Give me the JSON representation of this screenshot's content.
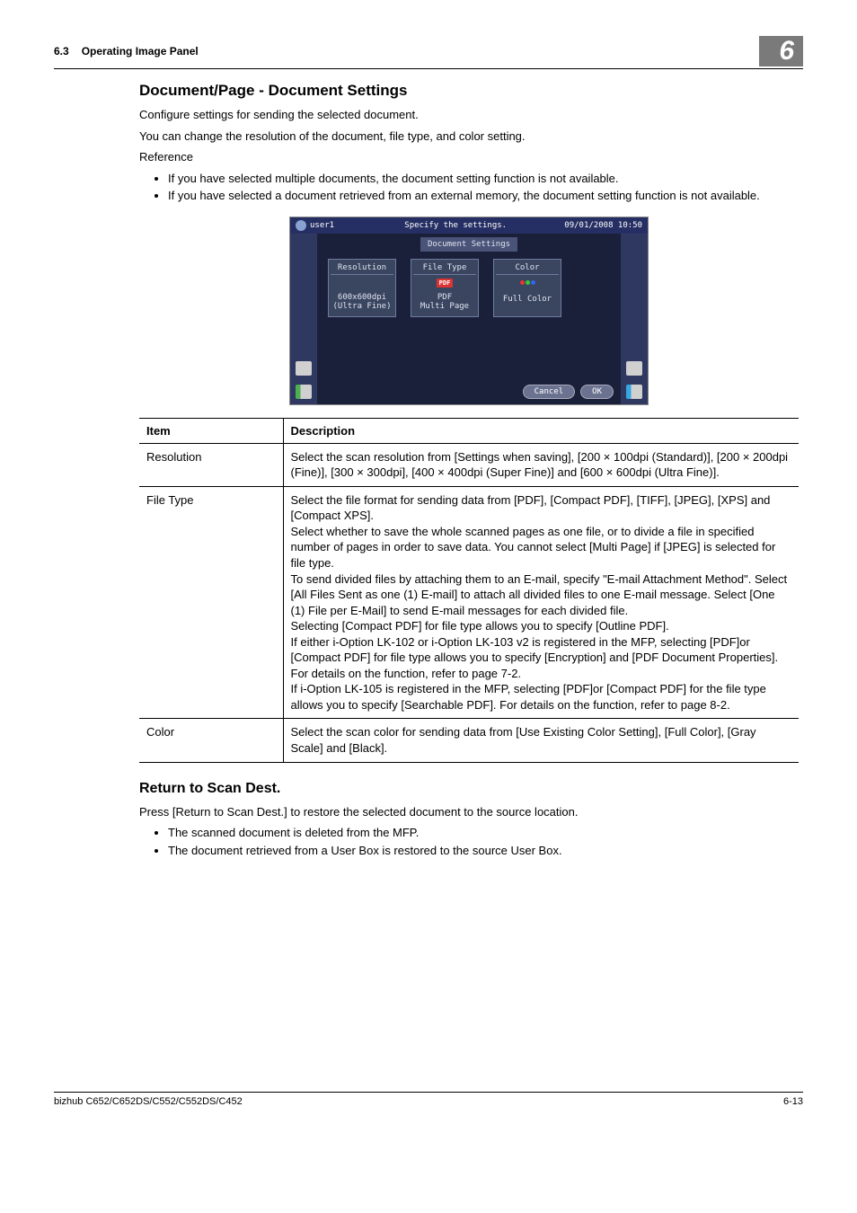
{
  "header": {
    "section_num": "6.3",
    "section_title": "Operating Image Panel",
    "chapter_num": "6"
  },
  "h2_docset": "Document/Page - Document Settings",
  "p_intro1": "Configure settings for sending the selected document.",
  "p_intro2": "You can change the resolution of the document, file type, and color setting.",
  "p_ref": "Reference",
  "bullets_ref": [
    "If you have selected multiple documents, the document setting function is not available.",
    "If you have selected a document retrieved from an external memory, the document setting function is not available."
  ],
  "mfp": {
    "user": "user1",
    "message": "Specify the settings.",
    "datetime": "09/01/2008  10:50",
    "panel_title": "Document Settings",
    "tiles": {
      "resolution": {
        "title": "Resolution",
        "line1": "600x600dpi",
        "line2": "(Ultra Fine)"
      },
      "filetype": {
        "title": "File Type",
        "badge": "PDF",
        "line1": "PDF",
        "line2": "Multi Page"
      },
      "color": {
        "title": "Color",
        "line1": "Full Color"
      }
    },
    "btn_cancel": "Cancel",
    "btn_ok": "OK"
  },
  "table": {
    "head_item": "Item",
    "head_desc": "Description",
    "rows": [
      {
        "item": "Resolution",
        "desc": "Select the scan resolution from [Settings when saving], [200 × 100dpi (Standard)], [200 × 200dpi (Fine)], [300 × 300dpi], [400 × 400dpi (Super Fine)] and [600 × 600dpi (Ultra Fine)]."
      },
      {
        "item": "File Type",
        "desc": "Select the file format for sending data from [PDF], [Compact PDF], [TIFF], [JPEG], [XPS] and [Compact XPS].\nSelect whether to save the whole scanned pages as one file, or to divide a file in specified number of pages in order to save data. You cannot select [Multi Page] if [JPEG] is selected for file type.\nTo send divided files by attaching them to an E-mail, specify \"E-mail Attachment Method\". Select [All Files Sent as one (1) E-mail] to attach all divided files to one E-mail message. Select [One (1) File per E-Mail] to send E-mail messages for each divided file.\nSelecting [Compact PDF] for file type allows you to specify [Outline PDF].\nIf either i-Option LK-102 or i-Option LK-103 v2 is registered in the MFP, selecting [PDF]or [Compact PDF] for file type allows you to specify [Encryption] and [PDF Document Properties]. For details on the function, refer to page 7-2.\nIf i-Option LK-105 is registered in the MFP, selecting [PDF]or [Compact PDF] for the file type allows you to specify [Searchable PDF]. For details on the function, refer to page 8-2."
      },
      {
        "item": "Color",
        "desc": "Select the scan color for sending data from [Use Existing Color Setting], [Full Color], [Gray Scale] and [Black]."
      }
    ]
  },
  "h2_return": "Return to Scan Dest.",
  "p_return": "Press [Return to Scan Dest.] to restore the selected document to the source location.",
  "bullets_return": [
    "The scanned document is deleted from the MFP.",
    "The document retrieved from a User Box is restored to the source User Box."
  ],
  "footer": {
    "model": "bizhub C652/C652DS/C552/C552DS/C452",
    "page": "6-13"
  }
}
